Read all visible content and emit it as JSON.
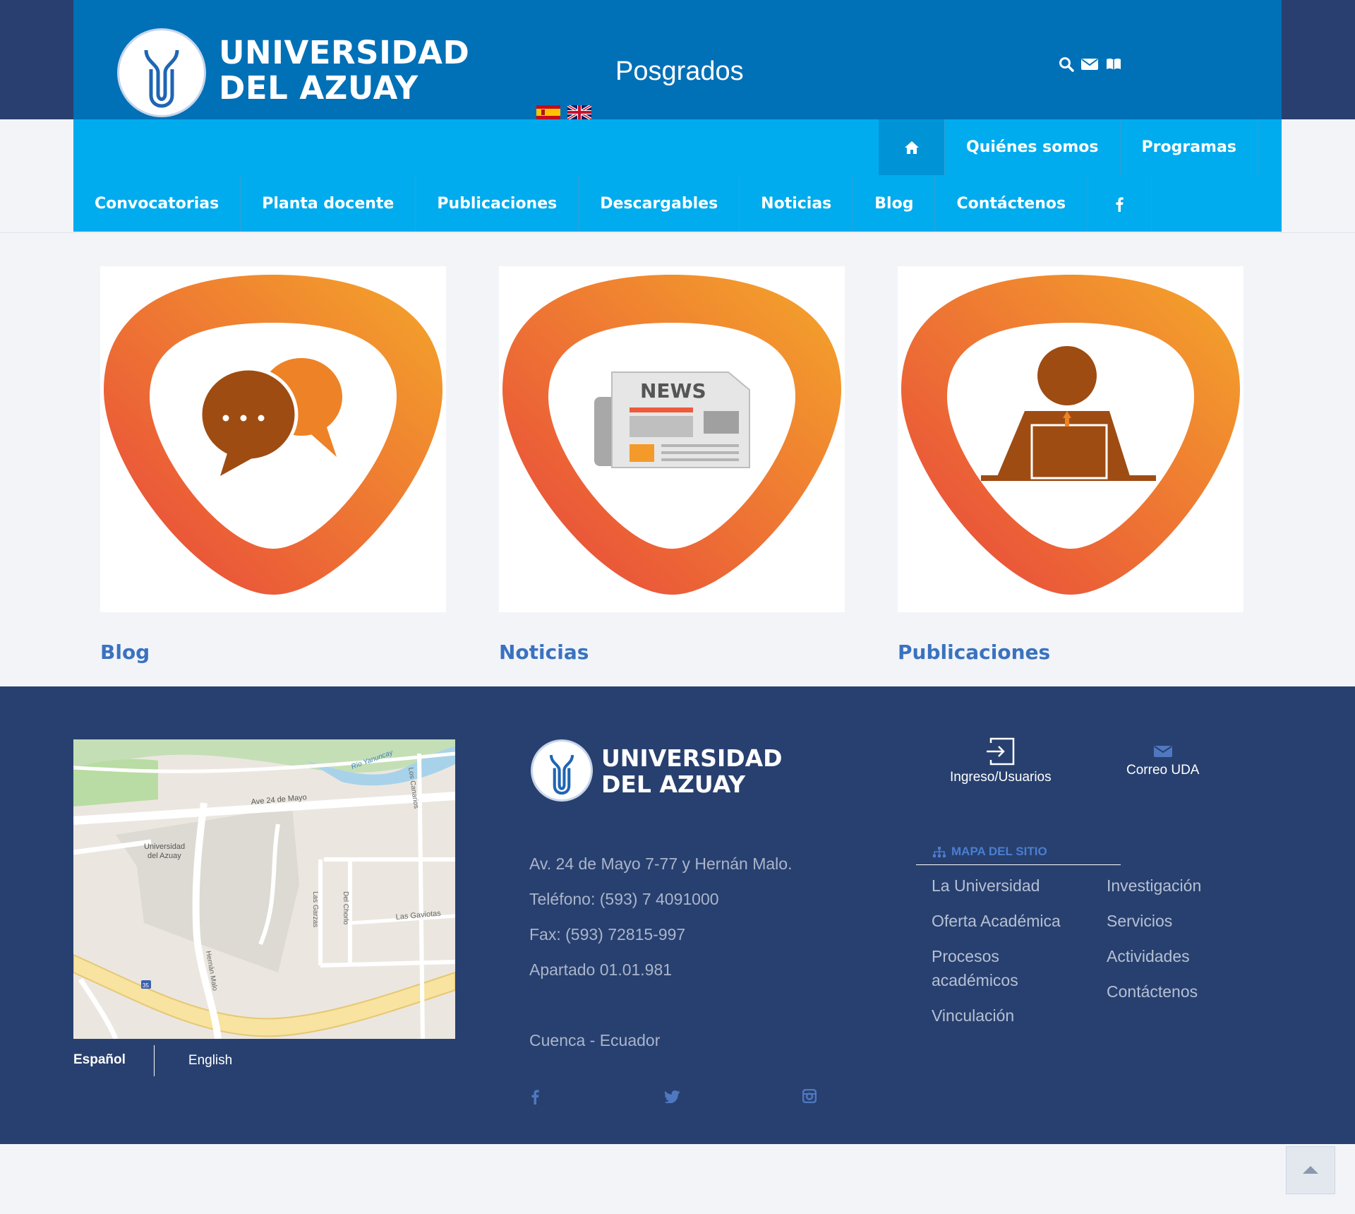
{
  "header": {
    "logo_line1": "UNIVERSIDAD",
    "logo_line2": "DEL AZUAY",
    "site_title": "Posgrados",
    "flags": [
      "spanish-flag",
      "english-flag"
    ],
    "tools": [
      "search-icon",
      "envelope-icon",
      "book-icon"
    ]
  },
  "nav": {
    "row1": [
      "Quiénes somos",
      "Programas"
    ],
    "row2": [
      "Convocatorias",
      "Planta docente",
      "Publicaciones",
      "Descargables",
      "Noticias",
      "Blog",
      "Contáctenos"
    ]
  },
  "cards": [
    {
      "title": "Blog",
      "icon": "chat-bubbles-icon"
    },
    {
      "title": "Noticias",
      "icon": "newspaper-icon",
      "icon_text": "NEWS"
    },
    {
      "title": "Publicaciones",
      "icon": "person-laptop-icon"
    }
  ],
  "map": {
    "labels": [
      "Ave 24 de Mayo",
      "Universidad",
      "del Azuay",
      "Los Canarios",
      "Las Garzas",
      "Del Chorlo",
      "Las Gaviotas",
      "Hernán Malo",
      "Río Yanuncay"
    ],
    "highway_badge": "35"
  },
  "footer": {
    "logo_line1": "UNIVERSIDAD",
    "logo_line2": "DEL AZUAY",
    "address": [
      "Av. 24 de Mayo 7-77 y Hernán Malo.",
      "Teléfono: (593) 7 4091000",
      "Fax: (593) 72815-997",
      "Apartado 01.01.981",
      "Cuenca - Ecuador"
    ],
    "lang_es": "Español",
    "lang_en": "English",
    "login_label": "Ingreso/Usuarios",
    "mail_label": "Correo UDA",
    "sitemap_title": "MAPA DEL SITIO",
    "links_left": [
      "La Universidad",
      "Oferta Académica",
      "Procesos académicos",
      "Vinculación"
    ],
    "links_right": [
      "Investigación",
      "Servicios",
      "Actividades",
      "Contáctenos"
    ],
    "social": [
      "facebook-icon",
      "twitter-icon",
      "instagram-icon"
    ]
  },
  "colors": {
    "header_blue": "#0070b7",
    "nav_cyan": "#00aced",
    "footer_navy": "#28406f",
    "title_blue": "#3a72c0",
    "orange": "#f08a2c"
  }
}
